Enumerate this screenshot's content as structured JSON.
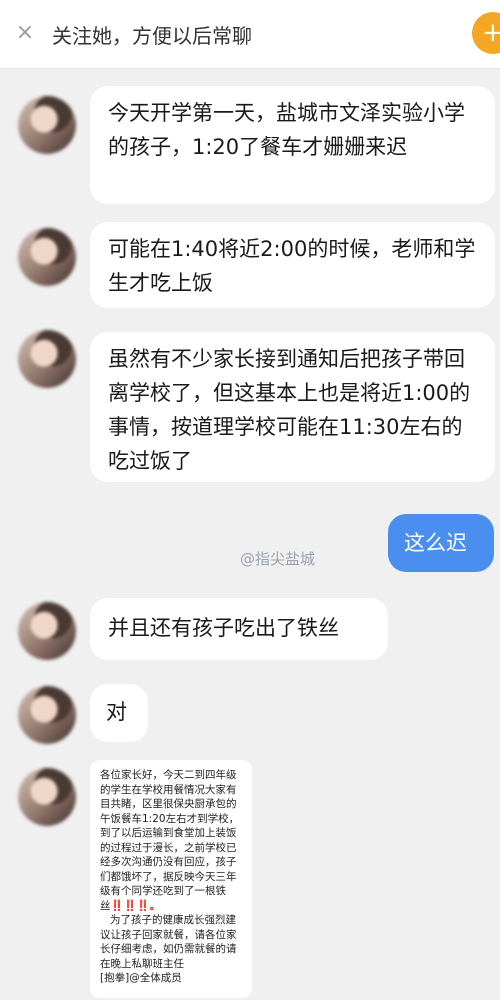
{
  "header": {
    "close_icon": "×",
    "follow_prompt": "关注她，方便以后常聊",
    "follow_button_icon": "+"
  },
  "messages": [
    {
      "sender": "other",
      "text": "今天开学第一天，盐城市文泽实验小学的孩子，1:20了餐车才姗姗来迟"
    },
    {
      "sender": "other",
      "text": "可能在1:40将近2:00的时候，老师和学生才吃上饭"
    },
    {
      "sender": "other",
      "text": "虽然有不少家长接到通知后把孩子带回离学校了，但这基本上也是将近1:00的事情，按道理学校可能在11:30左右的吃过饭了"
    },
    {
      "sender": "me",
      "text": "这么迟"
    },
    {
      "sender": "other",
      "text": "并且还有孩子吃出了铁丝"
    },
    {
      "sender": "other",
      "text": "对"
    }
  ],
  "watermark": "@指尖盐城",
  "notice_image": {
    "paragraph1": "各位家长好，今天二到四年级的学生在学校用餐情况大家有目共睹，区里很保央厨承包的午饭餐车1:20左右才到学校，到了以后运输到食堂加上装饭的过程过于漫长，之前学校已经多次沟通仍没有回应，孩子们都饿坏了，据反映今天三年级有个同学还吃到了一根铁丝",
    "exclaim": "‼️‼️",
    "exclaim2": "‼️。",
    "paragraph2": "为了孩子的健康成长强烈建议让孩子回家就餐，请各位家长仔细考虑，如仍需就餐的请在晚上私聊班主任",
    "closing": "[抱拳]@全体成员"
  },
  "colors": {
    "background": "#f0f0f0",
    "my_bubble": "#4a8ff0",
    "follow_button": "#f5a623"
  }
}
